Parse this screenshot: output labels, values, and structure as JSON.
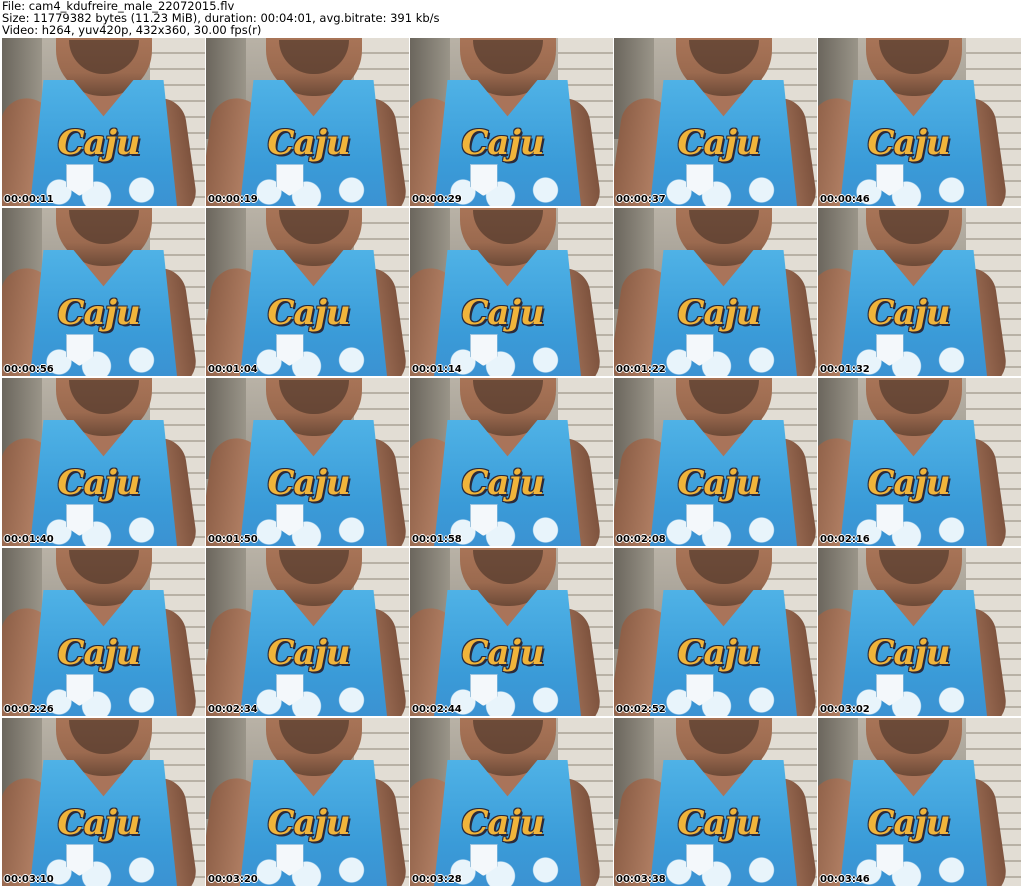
{
  "header": {
    "file_line": "File: cam4_kdufreire_male_22072015.flv",
    "size_line": "Size: 11779382 bytes (11.23 MiB), duration: 00:04:01, avg.bitrate: 391 kb/s",
    "video_line": "Video: h264, yuv420p, 432x360, 30.00 fps(r)"
  },
  "thumbnails": [
    {
      "time": "00:00:11"
    },
    {
      "time": "00:00:19"
    },
    {
      "time": "00:00:29"
    },
    {
      "time": "00:00:37"
    },
    {
      "time": "00:00:46"
    },
    {
      "time": "00:00:56"
    },
    {
      "time": "00:01:04"
    },
    {
      "time": "00:01:14"
    },
    {
      "time": "00:01:22"
    },
    {
      "time": "00:01:32"
    },
    {
      "time": "00:01:40"
    },
    {
      "time": "00:01:50"
    },
    {
      "time": "00:01:58"
    },
    {
      "time": "00:02:08"
    },
    {
      "time": "00:02:16"
    },
    {
      "time": "00:02:26"
    },
    {
      "time": "00:02:34"
    },
    {
      "time": "00:02:44"
    },
    {
      "time": "00:02:52"
    },
    {
      "time": "00:03:02"
    },
    {
      "time": "00:03:10"
    },
    {
      "time": "00:03:20"
    },
    {
      "time": "00:03:28"
    },
    {
      "time": "00:03:38"
    },
    {
      "time": "00:03:46"
    }
  ],
  "shirt_logo_text": "Caju",
  "colors": {
    "shirt": "#3a9bd8",
    "logo": "#f0b43a",
    "wall": "#e2ddd4"
  }
}
